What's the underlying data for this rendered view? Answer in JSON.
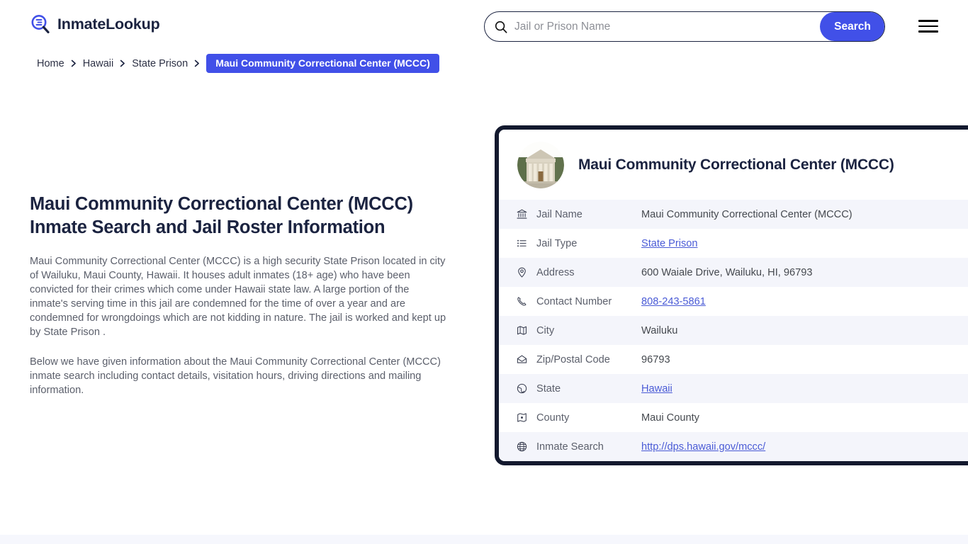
{
  "header": {
    "brand_name": "InmateLookup",
    "logo_icon": "magnifier-list-icon",
    "search": {
      "placeholder": "Jail or Prison Name",
      "value": "",
      "icon": "search-icon",
      "button_label": "Search"
    },
    "menu_icon": "hamburger-menu-icon"
  },
  "breadcrumb": {
    "items": [
      {
        "label": "Home",
        "active": false
      },
      {
        "label": "Hawaii",
        "active": false
      },
      {
        "label": "State Prison",
        "active": false
      },
      {
        "label": "Maui Community Correctional Center (MCCC)",
        "active": true
      }
    ],
    "separator_icon": "chevron-right-icon"
  },
  "main": {
    "page_title": "Maui Community Correctional Center (MCCC) Inmate Search and Jail Roster Information",
    "paragraph_1": "Maui Community Correctional Center (MCCC) is a high security State Prison located in city of Wailuku, Maui County, Hawaii. It houses adult inmates (18+ age) who have been convicted for their crimes which come under Hawaii state law. A large portion of the inmate's serving time in this jail are condemned for the time of over a year and are condemned for wrongdoings which are not kidding in nature. The jail is worked and kept up by State Prison .",
    "paragraph_2": "Below we have given information about the Maui Community Correctional Center (MCCC) inmate search including contact details, visitation hours, driving directions and mailing information."
  },
  "info_card": {
    "photo_icon": "courthouse-building-photo",
    "title": "Maui Community Correctional Center (MCCC)",
    "rows": [
      {
        "icon": "bank-icon",
        "label": "Jail Name",
        "value": "Maui Community Correctional Center (MCCC)",
        "link": false
      },
      {
        "icon": "list-icon",
        "label": "Jail Type",
        "value": "State Prison",
        "link": true
      },
      {
        "icon": "map-pin-icon",
        "label": "Address",
        "value": "600 Waiale Drive, Wailuku, HI, 96793",
        "link": false
      },
      {
        "icon": "phone-icon",
        "label": "Contact Number",
        "value": "808-243-5861",
        "link": true
      },
      {
        "icon": "map-icon",
        "label": "City",
        "value": "Wailuku",
        "link": false
      },
      {
        "icon": "envelope-icon",
        "label": "Zip/Postal Code",
        "value": "96793",
        "link": false
      },
      {
        "icon": "globe-pin-icon",
        "label": "State",
        "value": "Hawaii",
        "link": true
      },
      {
        "icon": "map-marker-icon",
        "label": "County",
        "value": "Maui County",
        "link": false
      },
      {
        "icon": "globe-icon",
        "label": "Inmate Search",
        "value": "http://dps.hawaii.gov/mccc/",
        "link": true
      }
    ]
  },
  "colors": {
    "accent_blue": "#4150e8",
    "link_blue": "#4a5bd6",
    "dark_navy": "#1b2340",
    "card_border": "#13192e",
    "row_alt": "#f4f5fb",
    "body_text": "#5b5f6b"
  }
}
